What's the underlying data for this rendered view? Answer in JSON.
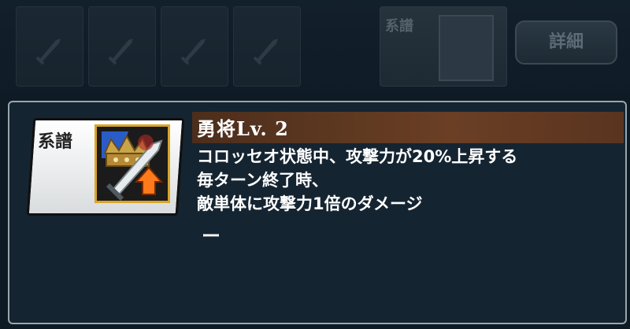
{
  "top_bar": {
    "slots": [
      "",
      "",
      "",
      ""
    ],
    "right_card_label": "系譜",
    "detail_button": "詳細"
  },
  "skill": {
    "card_label": "系譜",
    "name": "勇将Lv. 2",
    "description_lines": [
      "コロッセオ状態中、攻撃力が20%上昇する",
      "毎ターン終了時、",
      "敵単体に攻撃力1倍のダメージ"
    ],
    "extra": "ー"
  },
  "icons": [
    "sword-icon",
    "crown-icon",
    "attack-up-arrow-icon"
  ]
}
